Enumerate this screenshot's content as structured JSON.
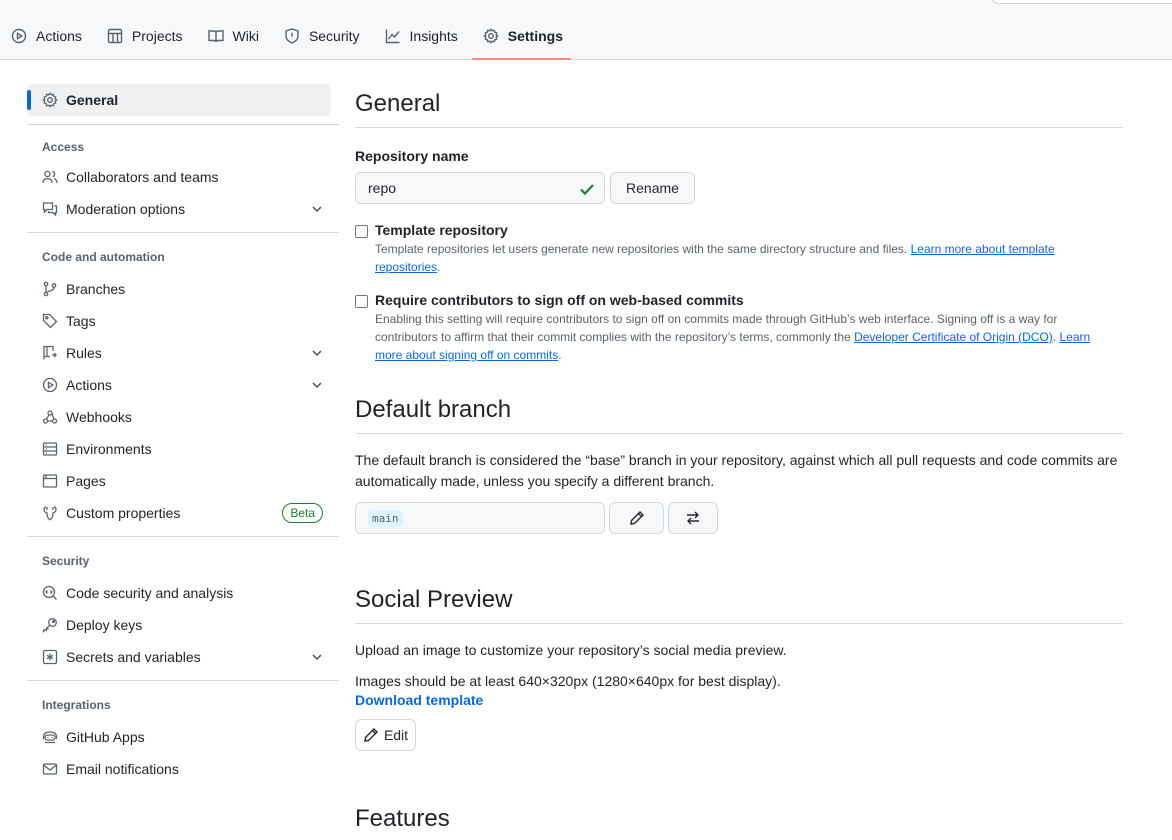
{
  "tabs": [
    {
      "label": "Actions",
      "icon": "play-icon"
    },
    {
      "label": "Projects",
      "icon": "table-icon"
    },
    {
      "label": "Wiki",
      "icon": "book-icon"
    },
    {
      "label": "Security",
      "icon": "shield-icon"
    },
    {
      "label": "Insights",
      "icon": "graph-icon"
    },
    {
      "label": "Settings",
      "icon": "gear-icon",
      "selected": true
    }
  ],
  "sidebar": {
    "general": "General",
    "access_heading": "Access",
    "collaborators": "Collaborators and teams",
    "moderation": "Moderation options",
    "code_heading": "Code and automation",
    "branches": "Branches",
    "tags": "Tags",
    "rules": "Rules",
    "actions": "Actions",
    "webhooks": "Webhooks",
    "environments": "Environments",
    "pages": "Pages",
    "custom_properties": "Custom properties",
    "beta": "Beta",
    "security_heading": "Security",
    "code_security": "Code security and analysis",
    "deploy_keys": "Deploy keys",
    "secrets": "Secrets and variables",
    "integrations_heading": "Integrations",
    "github_apps": "GitHub Apps",
    "email_notifications": "Email notifications"
  },
  "general": {
    "title": "General",
    "repo_name_label": "Repository name",
    "repo_name_value": "repo",
    "rename_button": "Rename",
    "template_label": "Template repository",
    "template_note": "Template repositories let users generate new repositories with the same directory structure and files.",
    "template_link": "Learn more about template repositories",
    "signoff_label": "Require contributors to sign off on web-based commits",
    "signoff_note_1": "Enabling this setting will require contributors to sign off on commits made through GitHub’s web interface. Signing off is a way for contributors to affirm that their commit complies with the repository’s terms, commonly the",
    "signoff_link_1": "Developer Certificate of Origin (DCO)",
    "signoff_link_2": "Learn more about signing off on commits"
  },
  "default_branch": {
    "title": "Default branch",
    "description": "The default branch is considered the “base” branch in your repository, against which all pull requests and code commits are automatically made, unless you specify a different branch.",
    "branch": "main"
  },
  "social_preview": {
    "title": "Social Preview",
    "line1": "Upload an image to customize your repository’s social media preview.",
    "line2": "Images should be at least 640×320px (1280×640px for best display).",
    "download": "Download template",
    "edit": "Edit"
  },
  "features": {
    "title": "Features"
  },
  "colors": {
    "accent": "#0969da",
    "tab_underline": "#fd8c73",
    "success": "#1a7f37"
  }
}
